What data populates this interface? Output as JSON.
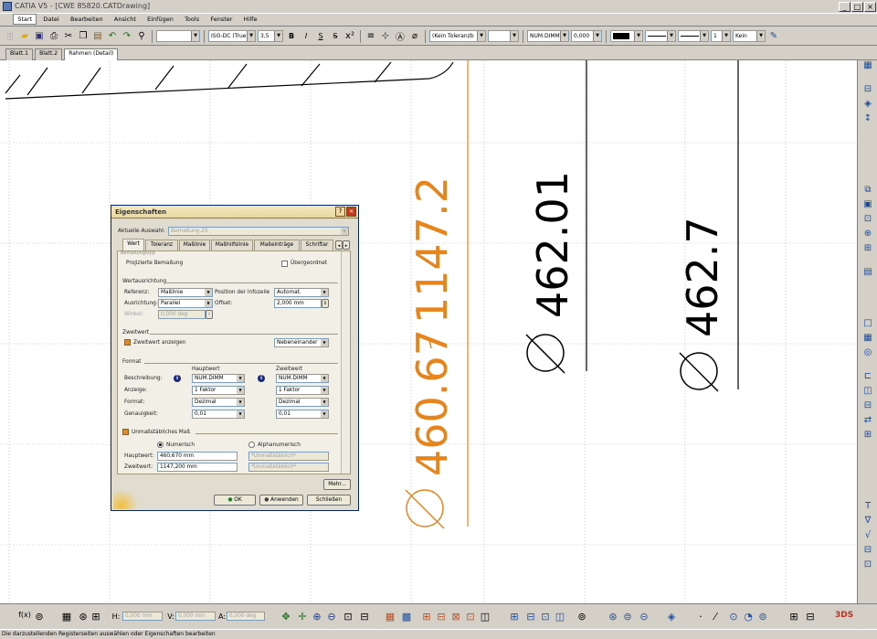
{
  "window": {
    "title": "CATIA V5 - [CWE 85820.CATDrawing]"
  },
  "menu": [
    "Start",
    "Datei",
    "Bearbeiten",
    "Ansicht",
    "Einfügen",
    "Tools",
    "Fenster",
    "Hilfe"
  ],
  "toolbar": {
    "style_combo": "",
    "font_combo": "ISO-DC (True...",
    "font_size": "3,5",
    "bold": "B",
    "italic": "I",
    "underline": "S",
    "tolerance_combo": "(Kein Toleranzb",
    "tolerance_combo2": "",
    "format_combo": "NUM.DIMM",
    "precision_combo": "0,000",
    "line_weight": "",
    "line_type": "",
    "line_type2": "",
    "count": "1",
    "fill_combo": "Kein"
  },
  "sheet_tabs": [
    "Blatt.1",
    "Blatt.2",
    "Rahmen (Detail)"
  ],
  "canvas": {
    "dims": [
      {
        "prefix": "⌀",
        "value": "460.67",
        "color": "#e8841c"
      },
      {
        "tol": "1147.2",
        "color": "#e8841c"
      },
      {
        "prefix": "⌀",
        "value": "462.01",
        "color": "#000000"
      },
      {
        "prefix": "⌀",
        "value": "462.7",
        "color": "#000000"
      }
    ]
  },
  "dialog": {
    "title": "Eigenschaften",
    "current_selection_label": "Aktuelle Auswahl:",
    "current_selection_value": "Bemaßung.25",
    "tabs": [
      "Wert",
      "Toleranz",
      "Maßlinie",
      "Maßhilfslinie",
      "Maßeinträge",
      "Schriftar"
    ],
    "cut_text": "Bemaßungstyp",
    "projected_label": "Projizierte Bemaßung",
    "driving_label": "Übergeordnet",
    "orientation_group": "Wertausrichtung",
    "reference_label": "Referenz:",
    "reference_value": "Maßlinie",
    "position_label": "Position der Infozeile",
    "position_value": "Automat.",
    "orientation_label": "Ausrichtung:",
    "orientation_value": "Parallel",
    "offset_label": "Offset:",
    "offset_value": "2,000 mm",
    "angle_label": "Winkel:",
    "angle_value": "0,000 deg",
    "dual_group": "Zweitwert",
    "show_dual_label": "Zweitwert anzeigen",
    "dual_layout_value": "Nebeneinander",
    "format_group": "Format",
    "main_value_header": "Hauptwert",
    "dual_value_header": "Zweitwert",
    "description_label": "Beschreibung:",
    "description_main": "NUM.DIMM",
    "description_dual": "NUM.DIMM",
    "display_label": "Anzeige:",
    "display_main": "1 Faktor",
    "display_dual": "1 Faktor",
    "format_label": "Format:",
    "format_main": "Dezimal",
    "format_dual": "Dezimal",
    "precision_label": "Genauigkeit:",
    "precision_main": "0,01",
    "precision_dual": "0,01",
    "fake_label": "Unmaßstäbliches Maß",
    "numeric_label": "Numerisch",
    "alpha_label": "Alphanumerisch",
    "main_label": "Hauptwert:",
    "main_value": "460,670 mm",
    "dual_label": "Zweitwert:",
    "dual_value": "1147,200 mm",
    "fake_main": "*Unmaßstäblich*",
    "fake_dual": "*Unmaßstäblich*",
    "more_button": "Mehr...",
    "ok_button": "OK",
    "apply_button": "Anwenden",
    "close_button": "Schließen"
  },
  "bottom": {
    "field1": "0,000 mm",
    "field2": "0,000 mm",
    "field3": "0,000 deg"
  },
  "status": "Die darzustellenden Registerseiten auswählen oder Eigenschaften bearbeiten"
}
